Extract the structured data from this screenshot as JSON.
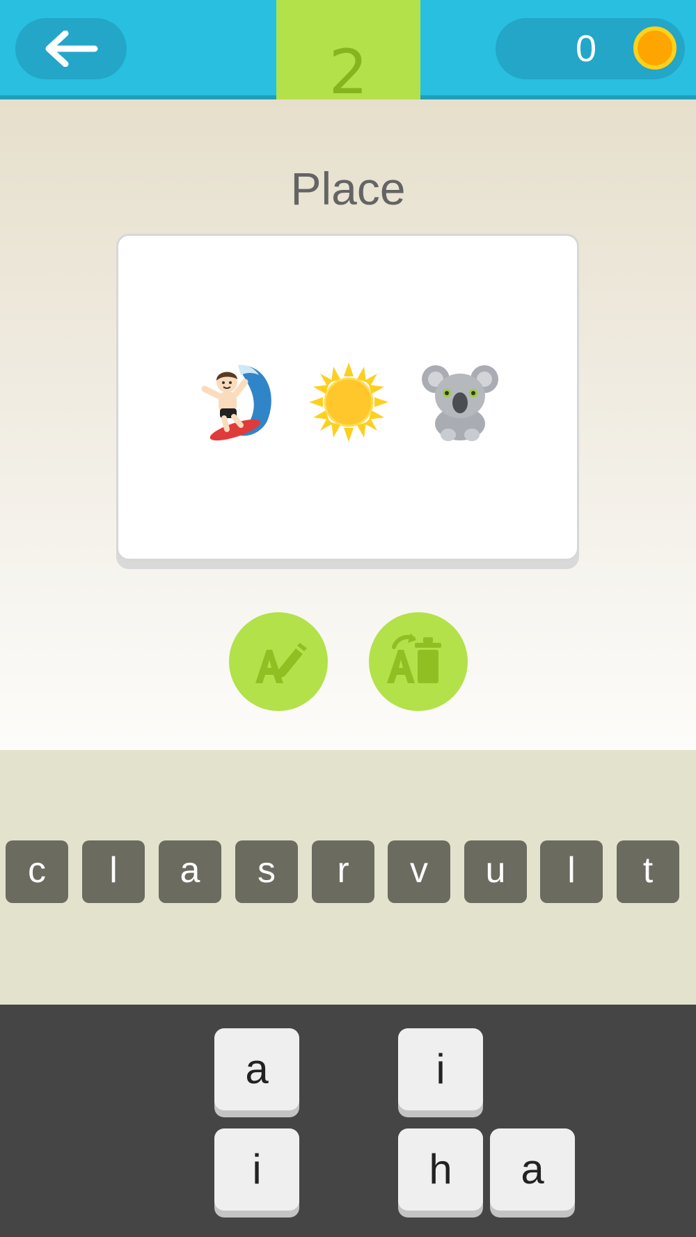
{
  "header": {
    "back_icon": "arrow-left-icon",
    "coins": "0",
    "coin_icon": "coin-icon",
    "level": "2"
  },
  "puzzle": {
    "category": "Place",
    "emojis": [
      "surfer-emoji",
      "sun-emoji",
      "koala-emoji"
    ]
  },
  "hints": {
    "reveal_letter_icon": "reveal-letter-icon",
    "remove_letters_icon": "remove-letters-icon"
  },
  "letter_slots": [
    "c",
    "l",
    "a",
    "s",
    "r",
    "v",
    "u",
    "l",
    "t"
  ],
  "keyboard": {
    "keys": [
      "a",
      "i",
      "i",
      "h",
      "a"
    ]
  },
  "colors": {
    "header_bg": "#29bfe0",
    "level_tab": "#b2e14a",
    "hint_button": "#b2e14a",
    "slot_bg": "#6b6b60",
    "keyboard_bg": "#454545"
  }
}
